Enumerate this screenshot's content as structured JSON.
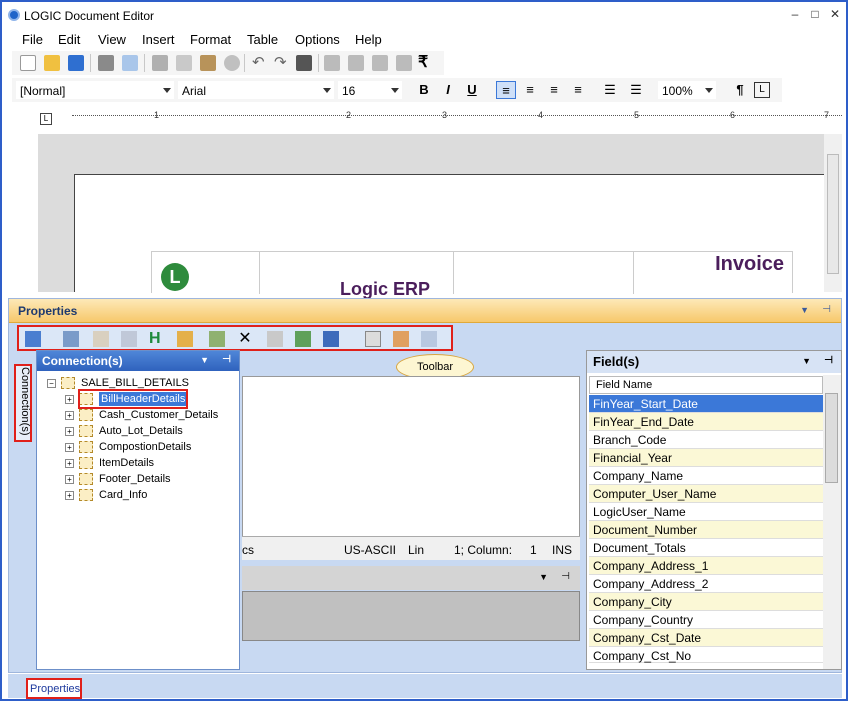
{
  "window": {
    "title": "LOGIC Document Editor",
    "minimize": "–",
    "maximize": "□",
    "close": "✕"
  },
  "menu": [
    "File",
    "Edit",
    "View",
    "Insert",
    "Format",
    "Table",
    "Options",
    "Help"
  ],
  "toolbar": {
    "icons": [
      "new-icon",
      "open-icon",
      "save-icon",
      "print-icon",
      "print-preview-icon",
      "cut-icon",
      "copy-icon",
      "paste-icon",
      "delete-icon",
      "undo-icon",
      "redo-icon",
      "find-icon",
      "insert-col-left-icon",
      "insert-col-right-icon",
      "insert-row-icon",
      "insert-row-below-icon",
      "rupee-icon"
    ],
    "rupee": "₹"
  },
  "format": {
    "style": "[Normal]",
    "font": "Arial",
    "size": "16",
    "bold": "B",
    "italic": "I",
    "underline": "U",
    "zoom": "100%",
    "paragraph": "¶"
  },
  "ruler": {
    "marks": [
      "1",
      "2",
      "3",
      "4",
      "5",
      "6",
      "7"
    ]
  },
  "document": {
    "invoice_title": "Invoice",
    "company": "Logic ERP",
    "logo_letter": "L"
  },
  "properties": {
    "title": "Properties",
    "toolbar_callout": "Toolbar",
    "toolbar_icons": [
      "properties-dropdown-icon",
      "connection-icon",
      "delete-connection-icon",
      "edit-icon",
      "header-icon",
      "add-field-icon",
      "export-icon",
      "close-x-icon",
      "remove-icon",
      "grid-icon",
      "book-icon",
      "page-icon",
      "table-icon",
      "layout-icon"
    ]
  },
  "side_tab": "Connection(s)",
  "connections": {
    "header": "Connection(s)",
    "root": "SALE_BILL_DETAILS",
    "items": [
      "BillHeaderDetails",
      "Cash_Customer_Details",
      "Auto_Lot_Details",
      "CompostionDetails",
      "ItemDetails",
      "Footer_Details",
      "Card_Info"
    ],
    "selected": "BillHeaderDetails"
  },
  "status": {
    "cs": "cs",
    "encoding": "US-ASCII",
    "line_label": "Lin",
    "line_value": "1; Column:",
    "column_value": "1",
    "mode": "INS"
  },
  "fields": {
    "header": "Field(s)",
    "column": "Field Name",
    "selected": "FinYear_Start_Date",
    "items": [
      "FinYear_Start_Date",
      "FinYear_End_Date",
      "Branch_Code",
      "Financial_Year",
      "Company_Name",
      "Computer_User_Name",
      "LogicUser_Name",
      "Document_Number",
      "Document_Totals",
      "Company_Address_1",
      "Company_Address_2",
      "Company_City",
      "Company_Country",
      "Company_Cst_Date",
      "Company_Cst_No"
    ]
  },
  "bottom_tab": "Properties",
  "colors": {
    "accent": "#3b78d8",
    "highlight": "#e0201a",
    "panel_blue": "#c8d9f2",
    "field_alt": "#fbf8d6"
  }
}
